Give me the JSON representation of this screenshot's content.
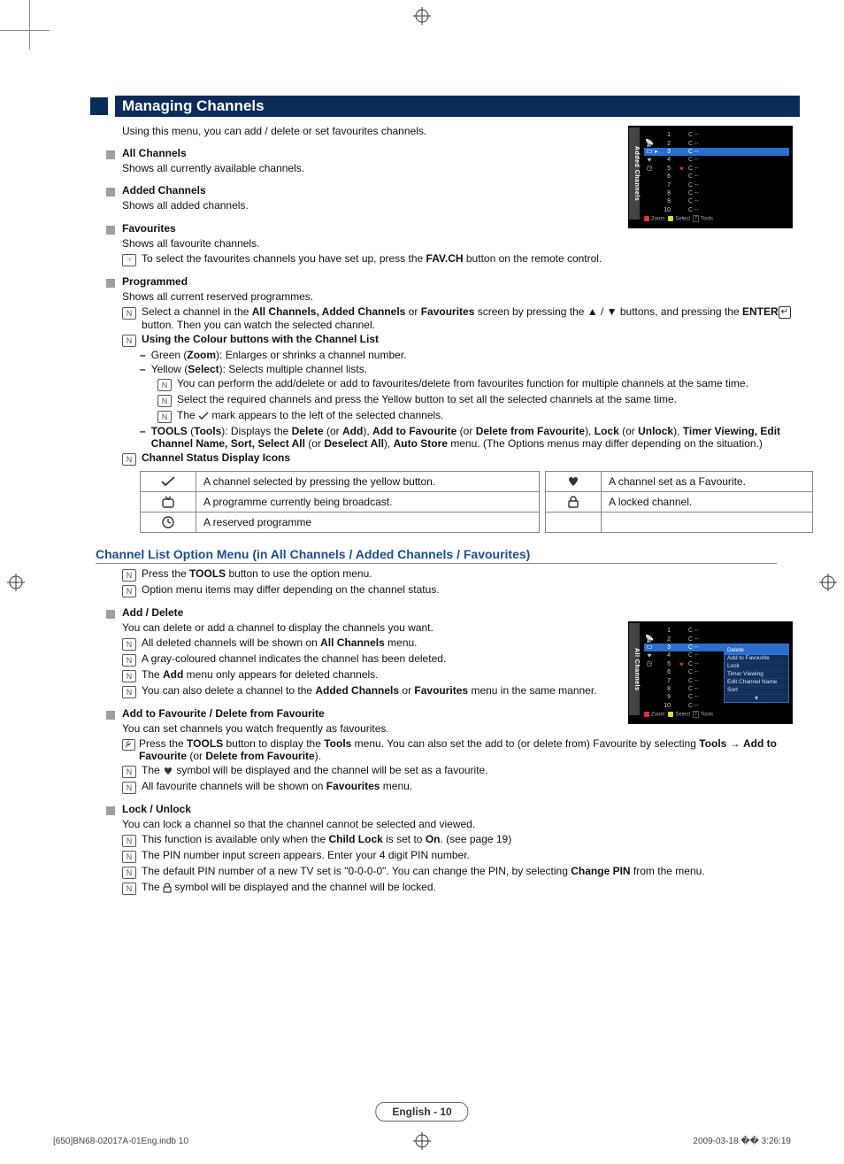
{
  "section_title": "Managing Channels",
  "intro": "Using this menu, you can add / delete or set favourites channels.",
  "all_channels": {
    "title": "All Channels",
    "desc": "Shows all currently available channels."
  },
  "added_channels": {
    "title": "Added Channels",
    "desc": "Shows all added channels."
  },
  "favourites": {
    "title": "Favourites",
    "desc": "Shows all favourite channels.",
    "note_prefix": "To select the favourites channels you have set up, press the ",
    "note_bold": "FAV.CH",
    "note_suffix": " button on the remote control."
  },
  "programmed": {
    "title": "Programmed",
    "desc": "Shows all current reserved programmes.",
    "note1_a": "Select a channel in the ",
    "note1_b": "All Channels, Added Channels",
    "note1_c": " or ",
    "note1_d": "Favourites",
    "note1_e": " screen by pressing the ▲ / ▼ buttons, and pressing the ",
    "note1_f": "ENTER",
    "note1_g": " button. Then you can watch the selected channel.",
    "note2_heading": "Using the Colour buttons with the Channel List",
    "green_a": "Green (",
    "green_b": "Zoom",
    "green_c": "): Enlarges or shrinks a channel number.",
    "yellow_a": "Yellow (",
    "yellow_b": "Select",
    "yellow_c": "): Selects multiple channel lists.",
    "yellow_sub1": "You can perform the add/delete or add to favourites/delete from favourites function for multiple channels at the same time.",
    "yellow_sub2": "Select the required channels and press the Yellow button to set all the selected channels at the same time.",
    "yellow_sub3_a": "The ",
    "yellow_sub3_b": " mark appears to the left of the selected channels.",
    "tools_a": "TOOLS",
    "tools_b": " (",
    "tools_c": "Tools",
    "tools_d": "): Displays the ",
    "tools_e": "Delete",
    "tools_f": " (or ",
    "tools_g": "Add",
    "tools_h": "), ",
    "tools_i": "Add to Favourite",
    "tools_j": " (or ",
    "tools_k": "Delete from Favourite",
    "tools_l": "), ",
    "tools_m": "Lock",
    "tools_n": " (or ",
    "tools_o": "Unlock",
    "tools_p": "), ",
    "tools_q": "Timer Viewing, Edit Channel Name, Sort, Select All",
    "tools_r": " (or ",
    "tools_s": "Deselect All",
    "tools_t": "), ",
    "tools_u": "Auto Store",
    "tools_v": " menu. (The Options menus may differ depending on the situation.)",
    "status_heading": "Channel Status Display Icons",
    "row1": "A channel selected by pressing the yellow button.",
    "row2": "A programme currently being broadcast.",
    "row3": "A reserved programme",
    "row1b": "A channel set as a Favourite.",
    "row2b": "A locked channel."
  },
  "subheading": "Channel List Option Menu (in All Channels / Added Channels / Favourites)",
  "sub_note1_a": "Press the ",
  "sub_note1_b": "TOOLS",
  "sub_note1_c": " button to use the option menu.",
  "sub_note2": "Option menu items may differ depending on the channel status.",
  "add_delete": {
    "title": "Add / Delete",
    "desc": "You can delete or add a channel to display the channels you want.",
    "n1_a": "All deleted channels will be shown on ",
    "n1_b": "All Channels",
    "n1_c": " menu.",
    "n2": "A gray-coloured channel indicates the channel has been deleted.",
    "n3_a": "The ",
    "n3_b": "Add",
    "n3_c": " menu only appears for deleted channels.",
    "n4_a": "You can also delete a channel to the ",
    "n4_b": "Added Channels",
    "n4_c": " or ",
    "n4_d": "Favourites",
    "n4_e": " menu in the same manner."
  },
  "add_fav": {
    "title": "Add to Favourite / Delete from Favourite",
    "desc": "You can set channels you watch frequently as favourites.",
    "t1_a": "Press the ",
    "t1_b": "TOOLS",
    "t1_c": " button to display the ",
    "t1_d": "Tools",
    "t1_e": " menu. You can also set the add to (or delete from) Favourite by selecting ",
    "t1_f": "Tools",
    "t1_g": " → ",
    "t1_h": "Add to Favourite",
    "t1_i": " (or ",
    "t1_j": "Delete from Favourite",
    "t1_k": ").",
    "n2_a": "The ",
    "n2_b": " symbol will be displayed and the channel will be set as a favourite.",
    "n3_a": "All favourite channels will be shown on ",
    "n3_b": "Favourites",
    "n3_c": " menu."
  },
  "lock": {
    "title": "Lock / Unlock",
    "desc": "You can lock a channel so that the channel cannot be selected and viewed.",
    "n1_a": "This function is available only when the ",
    "n1_b": "Child Lock",
    "n1_c": " is set to ",
    "n1_d": "On",
    "n1_e": ". (see page 19)",
    "n2": "The PIN number input screen appears. Enter your 4 digit PIN number.",
    "n3_a": "The default PIN number of a new TV set is \"0-0-0-0\". You can change the PIN, by selecting ",
    "n3_b": "Change PIN",
    "n3_c": " from the menu.",
    "n4_a": "The ",
    "n4_b": " symbol will be displayed and the channel will be locked."
  },
  "tv": {
    "side": "Added Channels",
    "rows": [
      "1",
      "2",
      "3",
      "4",
      "5",
      "6",
      "7",
      "8",
      "9",
      "10"
    ],
    "ch": "C --",
    "foot_zoom": "Zoom",
    "foot_select": "Select",
    "foot_tools": "Tools",
    "popup": [
      "Delete",
      "Add to Favourite",
      "Lock",
      "Timer Viewing",
      "Edit Channel Name",
      "Sort"
    ],
    "side2": "All Channels"
  },
  "footer": {
    "center": "English - 10",
    "left": "[650]BN68-02017A-01Eng.indb   10",
    "right": "2009-03-18   �� 3:26:19"
  }
}
